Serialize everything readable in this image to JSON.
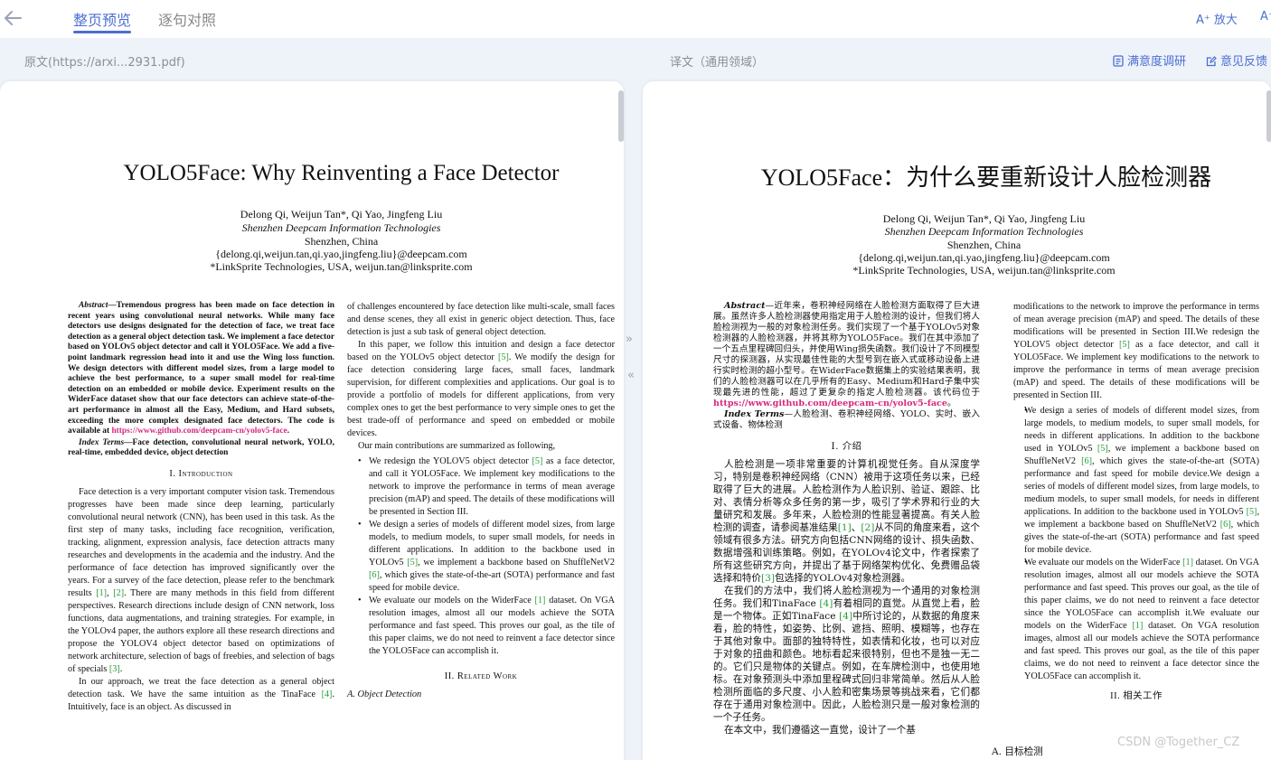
{
  "tabs": {
    "page_preview": "整页预览",
    "sentence_compare": "逐句对照"
  },
  "toolbar": {
    "zoom_in": "A⁺ 放大",
    "zoom_out_partial": "A⁻"
  },
  "labels": {
    "source": "原文(https://arxi...2931.pdf)",
    "translation": "译文（通用领域）",
    "survey": "满意度调研",
    "feedback": "意见反馈"
  },
  "watermark": "CSDN @Together_CZ",
  "colors": {
    "accent": "#4a6fd1",
    "link": "#d6287e",
    "ref": "#2a9d3b",
    "workarea": "#eef2f9"
  },
  "left_page": {
    "title": "YOLO5Face: Why Reinventing a Face Detector",
    "authors": "Delong Qi, Weijun Tan*, Qi Yao, Jingfeng Liu",
    "affiliation": "Shenzhen Deepcam Information Technologies",
    "city": "Shenzhen, China",
    "email1": "{delong.qi,weijun.tan,qi.yao,jingfeng.liu}@deepcam.com",
    "email2": "*LinkSprite Technologies, USA, weijun.tan@linksprite.com",
    "abstract_label": "Abstract",
    "abstract_text": "—Tremendous progress has been made on face detection in recent years using convolutional neural networks. While many face detectors use designs designated for the detection of face, we treat face detection as a general object detection task. We implement a face detector based on YOLOv5 object detector and call it YOLO5Face. We add a five-point landmark regression head into it and use the Wing loss function. We design detectors with different model sizes, from a large model to achieve the best performance, to a super small model for real-time detection on an embedded or mobile device. Experiment results on the WiderFace dataset show that our face detectors can achieve state-of-the-art performance in almost all the Easy, Medium, and Hard subsets, exceeding the more complex designated face detectors. The code is available at ",
    "abstract_link": "https://www.github.com/deepcam-cn/yolov5-face",
    "abstract_end": ".",
    "index_label": "Index Terms",
    "index_text": "—Face detection, convolutional neural network, YOLO, real-time, embedded device, object detection",
    "intro_heading": "I. Introduction",
    "intro_p1a": "Face detection is a very important computer vision task. Tremendous progresses have been made since deep learning, particularly convolutional neural network (CNN), has been used in this task. As the first step of many tasks, including face recognition, verification, tracking, alignment, expression analysis, face detection attracts many researches and developments in the academia and the industry. And the performance of face detection has improved significantly over the years. For a survey of the face detection, please refer to the benchmark results ",
    "intro_p1_ref1": "[1]",
    "intro_p1_sep": ", ",
    "intro_p1_ref2": "[2]",
    "intro_p1b": ". There are many methods in this field from different perspectives. Research directions include design of CNN network, loss functions, data augmentations, and training strategies. For example, in the YOLOv4 paper, the authors explore all these research directions and propose the YOLOV4 object detector based on optimizations of network architecture, selection of bags of freebies, and selection of bags of specials ",
    "intro_p1_ref3": "[3]",
    "intro_p1_end": ".",
    "intro_p2a": "In our approach, we treat the face detection as a general object detection task. We have the same intuition as the TinaFace ",
    "intro_p2_ref": "[4]",
    "intro_p2b": ". Intuitively, face is an object. As discussed in",
    "col2_p1": "of challenges encountered by face detection like multi-scale, small faces and dense scenes, they all exist in generic object detection. Thus, face detection is just a sub task of general object detection.",
    "col2_p2a": "In this paper, we follow this intuition and design a face detector based on the YOLOv5 object detector ",
    "col2_p2_ref": "[5]",
    "col2_p2b": ". We modify the design for face detection considering large faces, small faces, landmark supervision, for different complexities and applications. Our goal is to provide a portfolio of models for different applications, from very complex ones to get the best performance to very simple ones to get the best trade-off of performance and speed on embedded or mobile devices.",
    "col2_p3": "Our main contributions are summarized as following,",
    "bullet1a": "We redesign the YOLOV5 object detector ",
    "bullet1_ref": "[5]",
    "bullet1b": " as a face detector, and call it YOLO5Face. We implement key modifications to the network to improve the performance in terms of mean average precision (mAP) and speed. The details of these modifications will be presented in Section III.",
    "bullet2a": "We design a series of models of different model sizes, from large models, to medium models, to super small models, for needs in different applications. In addition to the backbone used in YOLOv5 ",
    "bullet2_ref1": "[5]",
    "bullet2b": ", we implement a backbone based on ShuffleNetV2 ",
    "bullet2_ref2": "[6]",
    "bullet2c": ", which gives the state-of-the-art (SOTA) performance and fast speed for mobile device.",
    "bullet3a": "We evaluate our models on the WiderFace ",
    "bullet3_ref": "[1]",
    "bullet3b": " dataset. On VGA resolution images, almost all our models achieve the SOTA performance and fast speed. This proves our goal, as the tile of this paper claims, we do not need to reinvent a face detector since the YOLO5Face can accomplish it.",
    "related_heading": "II. Related Work",
    "related_sub": "A. Object Detection"
  },
  "right_page": {
    "title": "YOLO5Face：为什么要重新设计人脸检测器",
    "authors": "Delong Qi, Weijun Tan*, Qi Yao, Jingfeng Liu",
    "affiliation": "Shenzhen Deepcam Information Technologies",
    "city": "Shenzhen, China",
    "email1": "{delong.qi,weijun.tan,qi.yao,jingfeng.liu}@deepcam.com",
    "email2": "*LinkSprite Technologies, USA, weijun.tan@linksprite.com",
    "abstract_label": "Abstract",
    "abstract_text": "—近年来，卷积神经网络在人脸检测方面取得了巨大进展。虽然许多人脸检测器使用指定用于人脸检测的设计，但我们将人脸检测视为一般的对象检测任务。我们实现了一个基于YOLOv5对象检测器的人脸检测器，并将其称为YOLO5Face。我们在其中添加了一个五点里程碑回归头，并使用Wing损失函数。我们设计了不同模型尺寸的探测器，从实现最佳性能的大型号到在嵌入式或移动设备上进行实时检测的超小型号。在WiderFace数据集上的实验结果表明，我们的人脸检测器可以在几乎所有的Easy、Medium和Hard子集中实现最先进的性能，超过了更复杂的指定人脸检测器。该代码位于",
    "abstract_link": "https://www.github.com/deepcam-cn/yolov5-face",
    "abstract_end": "。",
    "index_label": "Index Terms",
    "index_text": "—人脸检测、卷积神经网络、YOLO、实时、嵌入式设备、物体检测",
    "intro_heading": "I. 介绍",
    "intro_p1a": "人脸检测是一项非常重要的计算机视觉任务。自从深度学习，特别是卷积神经网络（CNN）被用于这项任务以来，已经取得了巨大的进展。人脸检测作为人脸识别、验证、跟踪、比对、表情分析等众多任务的第一步，吸引了学术界和行业的大量研究和发展。多年来，人脸检测的性能显著提高。有关人脸检测的调查，请参阅基准结果",
    "intro_p1_ref1": "[1]",
    "intro_p1_sep": "、",
    "intro_p1_ref2": "[2]",
    "intro_p1b": "从不同的角度来看，这个领域有很多方法。研究方向包括CNN网络的设计、损失函数、数据增强和训练策略。例如，在YOLOv4论文中，作者探索了所有这些研究方向，并提出了基于网络架构优化、免费赠品袋选择和特价",
    "intro_p1_ref3": "[3]",
    "intro_p1_end": "包选择的YOLOv4对象检测器。",
    "intro_p2a": "在我们的方法中，我们将人脸检测视为一个通用的对象检测任务。我们和TinaFace ",
    "intro_p2_ref": "[4]",
    "intro_p2b": "有着相同的直觉。从直觉上看，脸是一个物体。正如TinaFace ",
    "intro_p2_ref2": "[4]",
    "intro_p2c": "中所讨论的，从数据的角度来看，脸的特性，如姿势、比例、遮挡、照明、模糊等，也存在于其他对象中。面部的独特特性，如表情和化妆，也可以对应于对象的扭曲和颜色。地标看起来很特别，但也不是独一无二的。它们只是物体的关键点。例如，在车牌检测中，也使用地标。在对象预测头中添加里程碑式回归非常简单。然后从人脸检测所面临的多尺度、小人脸和密集场景等挑战来看，它们都存在于通用对象检测中。因此，人脸检测只是一般对象检测的一个子任务。",
    "intro_p3": "在本文中，我们遵循这一直觉，设计了一个基",
    "col2_p1": "modifications to the network to improve the performance in terms of mean average precision (mAP) and speed. The details of these modifications will be presented in Section III.We redesign the YOLOV5 object detector ",
    "col2_p1_ref": "[5]",
    "col2_p1b": " as a face detector, and call it YOLO5Face. We implement key modifications to the network to improve the performance in terms of mean average precision (mAP) and speed. The details of these modifications will be presented in Section III.",
    "bullet1a": "We design a series of models of different model sizes, from large models, to medium models, to super small models, for needs in different applications. In addition to the backbone used in YOLOv5 ",
    "bullet1_ref1": "[5]",
    "bullet1b": ", we implement a backbone based on ShuffleNetV2 ",
    "bullet1_ref2": "[6]",
    "bullet1c": ", which gives the state-of-the-art (SOTA) performance and fast speed for mobile device.We design a series of models of different model sizes, from large models, to medium models, to super small models, for needs in different applications. In addition to the backbone used in YOLOv5 ",
    "bullet1_ref3": "[5]",
    "bullet1d": ", we implement a backbone based on ShuffleNetV2 ",
    "bullet1_ref4": "[6]",
    "bullet1e": ", which gives the state-of-the-art (SOTA) performance and fast speed for mobile device.",
    "bullet2a": "We evaluate our models on the WiderFace ",
    "bullet2_ref1": "[1]",
    "bullet2b": " dataset. On VGA resolution images, almost all our models achieve the SOTA performance and fast speed. This proves our goal, as the tile of this paper claims, we do not need to reinvent a face detector since the YOLO5Face can accomplish it.We evaluate our models on the WiderFace ",
    "bullet2_ref2": "[1]",
    "bullet2c": " dataset. On VGA resolution images, almost all our models achieve the SOTA performance and fast speed. This proves our goal, as the tile of this paper claims, we do not need to reinvent a face detector since the YOLO5Face can accomplish it.",
    "related_heading": "II. 相关工作",
    "related_sub": "A. 目标检测"
  }
}
